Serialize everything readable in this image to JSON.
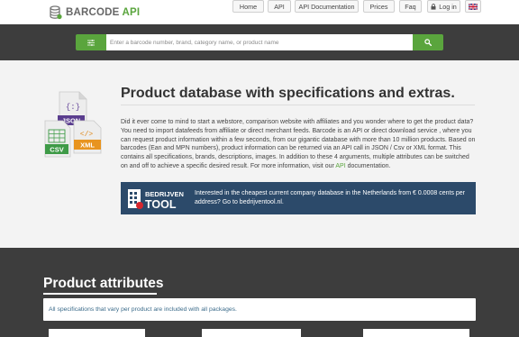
{
  "header": {
    "logo_text_main": "BARCODE ",
    "logo_text_accent": "API",
    "nav": [
      {
        "label": "Home"
      },
      {
        "label": "API"
      },
      {
        "label": "API Documentation"
      },
      {
        "label": "Prices"
      },
      {
        "label": "Faq"
      },
      {
        "label": "Log in"
      }
    ]
  },
  "search": {
    "placeholder": "Enter a barcode number, brand, category name, or product name"
  },
  "main": {
    "icon_labels": [
      "JSON",
      "XML",
      "CSV"
    ],
    "title": "Product database with specifications and extras.",
    "intro_before_link": "Did it ever come to mind to start a webstore, comparison website with affiliates and you wonder where to get the product data? You need to import datafeeds from affiliate or direct merchant feeds. Barcode is an API or direct download service , where you can request product information within a few seconds, from our gigantic database with more than 10 million products. Based on barcodes (Ean and MPN numbers), product information can be returned via an API call in JSON / Csv or XML format. This contains all specifications, brands, descriptions, images. In addition to these 4 arguments, multiple attributes can be switched on and off to achieve a specific desired result. For more information, visit our ",
    "intro_link": "API",
    "intro_after_link": " documentation.",
    "promo": {
      "logo_top": "BEDRIJVEN",
      "logo_bottom": "TOOL",
      "text": "Interested in the cheapest current company database in the Netherlands from € 0.0008 cents per address? Go to bedrijventool.nl."
    }
  },
  "attributes": {
    "title": "Product attributes",
    "note": "All specifications that vary per product are included with all packages."
  },
  "colors": {
    "brand_green": "#5aa53d",
    "dark_band": "#3d3d3d",
    "promo_blue": "#2c4a6a"
  },
  "icons": [
    "database-icon",
    "lock-icon",
    "flag-uk-icon",
    "sliders-icon",
    "search-icon"
  ]
}
